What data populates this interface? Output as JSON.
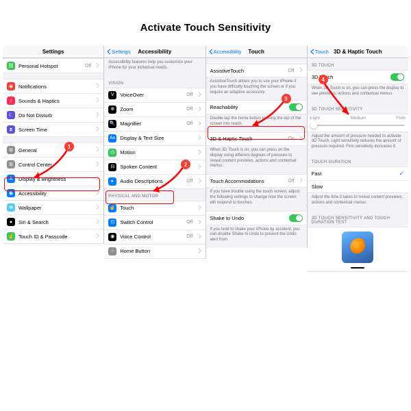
{
  "title": "Activate Touch Sensitivity",
  "panel1": {
    "nav_title": "Settings",
    "rows": [
      {
        "icon_bg": "#34c759",
        "glyph": "⛓",
        "label": "Personal Hotspot",
        "value": "Off"
      },
      {
        "icon_bg": "#ff3b30",
        "glyph": "◉",
        "label": "Notifications"
      },
      {
        "icon_bg": "#ff2d55",
        "glyph": "♪",
        "label": "Sounds & Haptics"
      },
      {
        "icon_bg": "#5856d6",
        "glyph": "☾",
        "label": "Do Not Disturb"
      },
      {
        "icon_bg": "#5856d6",
        "glyph": "⧗",
        "label": "Screen Time"
      },
      {
        "icon_bg": "#8e8e93",
        "glyph": "⚙",
        "label": "General"
      },
      {
        "icon_bg": "#8e8e93",
        "glyph": "⊞",
        "label": "Control Center"
      },
      {
        "icon_bg": "#007aff",
        "glyph": "A",
        "label": "Display & Brightness"
      },
      {
        "icon_bg": "#007aff",
        "glyph": "◉",
        "label": "Accessibility"
      },
      {
        "icon_bg": "#5ac8fa",
        "glyph": "❀",
        "label": "Wallpaper"
      },
      {
        "icon_bg": "#000000",
        "glyph": "●",
        "label": "Siri & Search"
      },
      {
        "icon_bg": "#34c759",
        "glyph": "☝",
        "label": "Touch ID & Passcode"
      }
    ]
  },
  "panel2": {
    "back": "Settings",
    "nav_title": "Accessibility",
    "intro": "Accessibility features help you customize your iPhone for your individual needs.",
    "section_vision": "VISION",
    "vision_rows": [
      {
        "icon_bg": "#000000",
        "glyph": "V",
        "label": "VoiceOver",
        "value": "Off"
      },
      {
        "icon_bg": "#000000",
        "glyph": "⊕",
        "label": "Zoom",
        "value": "Off"
      },
      {
        "icon_bg": "#000000",
        "glyph": "🔍",
        "label": "Magnifier",
        "value": "Off"
      },
      {
        "icon_bg": "#007aff",
        "glyph": "Aᴀ",
        "label": "Display & Text Size"
      },
      {
        "icon_bg": "#34c759",
        "glyph": "◷",
        "label": "Motion"
      },
      {
        "icon_bg": "#000000",
        "glyph": "⊟",
        "label": "Spoken Content"
      },
      {
        "icon_bg": "#007aff",
        "glyph": "▸",
        "label": "Audio Descriptions",
        "value": "Off"
      }
    ],
    "section_motor": "PHYSICAL AND MOTOR",
    "motor_rows": [
      {
        "icon_bg": "#007aff",
        "glyph": "☝",
        "label": "Touch"
      },
      {
        "icon_bg": "#007aff",
        "glyph": "⊡",
        "label": "Switch Control",
        "value": "Off"
      },
      {
        "icon_bg": "#000000",
        "glyph": "◉",
        "label": "Voice Control",
        "value": "Off"
      },
      {
        "icon_bg": "#8e8e93",
        "glyph": "○",
        "label": "Home Button"
      }
    ]
  },
  "panel3": {
    "back": "Accessibility",
    "nav_title": "Touch",
    "r1_label": "AssistiveTouch",
    "r1_value": "Off",
    "r1_note": "AssistiveTouch allows you to use your iPhone if you have difficulty touching the screen or if you require an adaptive accessory.",
    "r2_label": "Reachability",
    "r2_note": "Double-tap the home button to bring the top of the screen into reach.",
    "r3_label": "3D & Haptic Touch",
    "r3_value": "On",
    "r3_note": "When 3D Touch is on, you can press on the display using different degrees of pressure to reveal content previews, actions and contextual menus.",
    "r4_label": "Touch Accommodations",
    "r4_value": "Off",
    "r4_note": "If you have trouble using the touch screen, adjust the following settings to change how the screen will respond to touches.",
    "r5_label": "Shake to Undo",
    "r5_note": "If you tend to shake your iPhone by accident, you can disable Shake to Undo to prevent the Undo alert from"
  },
  "panel4": {
    "back": "Touch",
    "nav_title": "3D & Haptic Touch",
    "s1": "3D TOUCH",
    "s1_label": "3D Touch",
    "s1_note": "When 3D Touch is on, you can press the display to see previews, actions and contextual menus.",
    "s2": "3D TOUCH SENSITIVITY",
    "slider": {
      "light": "Light",
      "medium": "Medium",
      "firm": "Firm"
    },
    "s2_note": "Adjust the amount of pressure needed to activate 3D Touch. Light sensitivity reduces the amount of pressure required. Firm sensitivity increases it.",
    "s3": "TOUCH DURATION",
    "fast": "Fast",
    "slow": "Slow",
    "s3_note": "Adjust the time it takes to reveal content previews, actions and contextual menus.",
    "s4": "3D TOUCH SENSITIVITY AND TOUCH DURATION TEST"
  },
  "steps": {
    "1": "1",
    "2": "2",
    "3": "3",
    "4": "4"
  }
}
